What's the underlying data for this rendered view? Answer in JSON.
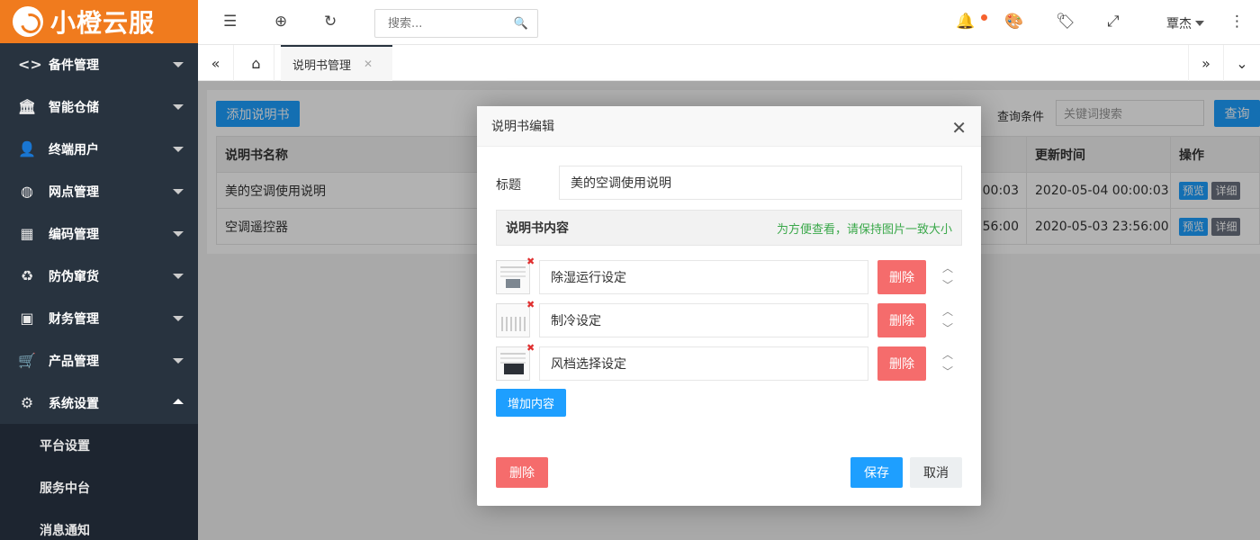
{
  "brand": {
    "name": "小橙云服",
    "accent": "#f07b1e"
  },
  "sidebar": {
    "items": [
      {
        "label": "备件管理",
        "icon": "code-icon"
      },
      {
        "label": "智能仓储",
        "icon": "bank-icon"
      },
      {
        "label": "终端用户",
        "icon": "user-icon"
      },
      {
        "label": "网点管理",
        "icon": "globe-icon"
      },
      {
        "label": "编码管理",
        "icon": "grid-icon"
      },
      {
        "label": "防伪窜货",
        "icon": "recycle-icon"
      },
      {
        "label": "财务管理",
        "icon": "money-icon"
      },
      {
        "label": "产品管理",
        "icon": "cart-icon"
      },
      {
        "label": "系统设置",
        "icon": "gear-icon"
      }
    ],
    "subitems": [
      {
        "label": "平台设置"
      },
      {
        "label": "服务中台"
      },
      {
        "label": "消息通知"
      }
    ]
  },
  "header": {
    "search_placeholder": "搜索...",
    "user": "覃杰"
  },
  "tabs": [
    {
      "label": "说明书管理"
    }
  ],
  "main": {
    "add_label": "添加说明书",
    "query_label": "查询条件",
    "query_placeholder": "关键词搜索",
    "query_button": "查询",
    "columns": {
      "name": "说明书名称",
      "updated": "更新时间",
      "actions": "操作"
    },
    "rows": [
      {
        "name": "美的空调使用说明",
        "created_tail": "00:03",
        "updated": "2020-05-04 00:00:03"
      },
      {
        "name": "空调遥控器",
        "created_tail": "56:00",
        "updated": "2020-05-03 23:56:00"
      }
    ],
    "preview_label": "预览",
    "detail_label": "详细"
  },
  "modal": {
    "title": "说明书编辑",
    "title_label": "标题",
    "title_value": "美的空调使用说明",
    "section_title": "说明书内容",
    "section_hint": "为方便查看，请保持图片一致大小",
    "entries": [
      {
        "text": "除湿运行设定"
      },
      {
        "text": "制冷设定"
      },
      {
        "text": "风档选择设定"
      }
    ],
    "row_delete": "删除",
    "add_content": "增加内容",
    "delete": "删除",
    "save": "保存",
    "cancel": "取消"
  }
}
